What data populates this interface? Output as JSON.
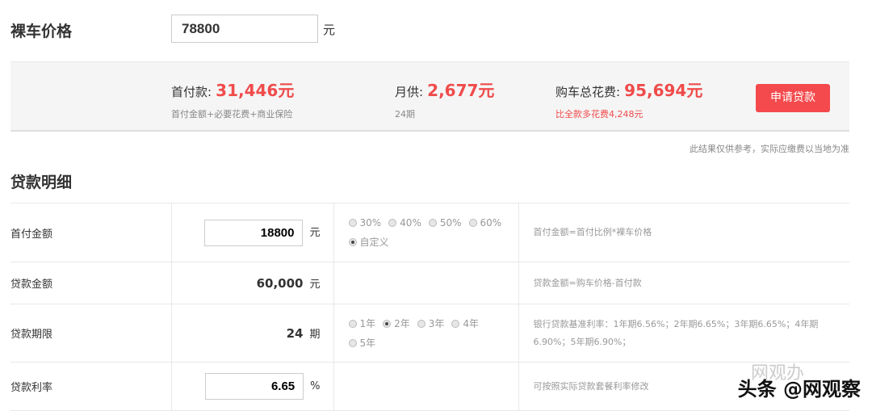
{
  "price": {
    "label": "裸车价格",
    "value": "78800",
    "unit": "元"
  },
  "summary": {
    "down": {
      "label": "首付款:",
      "value": "31,446元",
      "sub": "首付金额+必要花费+商业保险"
    },
    "monthly": {
      "label": "月供:",
      "value": "2,677元",
      "sub": "24期"
    },
    "total": {
      "label": "购车总花费:",
      "value": "95,694元",
      "sub": "比全款多花费4,248元"
    },
    "apply_button": "申请贷款"
  },
  "disclaimer": "此结果仅供参考，实际应缴费以当地为准",
  "details": {
    "title": "贷款明细",
    "rows": [
      {
        "label": "首付金额",
        "value": "18800",
        "unit": "元",
        "options": [
          {
            "label": "30%",
            "checked": false
          },
          {
            "label": "40%",
            "checked": false
          },
          {
            "label": "50%",
            "checked": false
          },
          {
            "label": "60%",
            "checked": false
          },
          {
            "label": "自定义",
            "checked": true
          }
        ],
        "note": "首付金额=首付比例*裸车价格"
      },
      {
        "label": "贷款金额",
        "value": "60,000",
        "unit": "元",
        "note": "贷款金额=购车价格-首付款"
      },
      {
        "label": "贷款期限",
        "value": "24",
        "unit": "期",
        "options": [
          {
            "label": "1年",
            "checked": false
          },
          {
            "label": "2年",
            "checked": true
          },
          {
            "label": "3年",
            "checked": false
          },
          {
            "label": "4年",
            "checked": false
          },
          {
            "label": "5年",
            "checked": false
          }
        ],
        "note": "银行贷款基准利率：1年期6.56%；2年期6.65%；3年期6.65%；4年期6.90%；5年期6.90%；"
      },
      {
        "label": "贷款利率",
        "value": "6.65",
        "unit": "%",
        "note": "可按照实际贷款套餐利率修改"
      }
    ]
  },
  "watermark": {
    "text": "头条 @网观察",
    "logo_text": "网观办"
  }
}
